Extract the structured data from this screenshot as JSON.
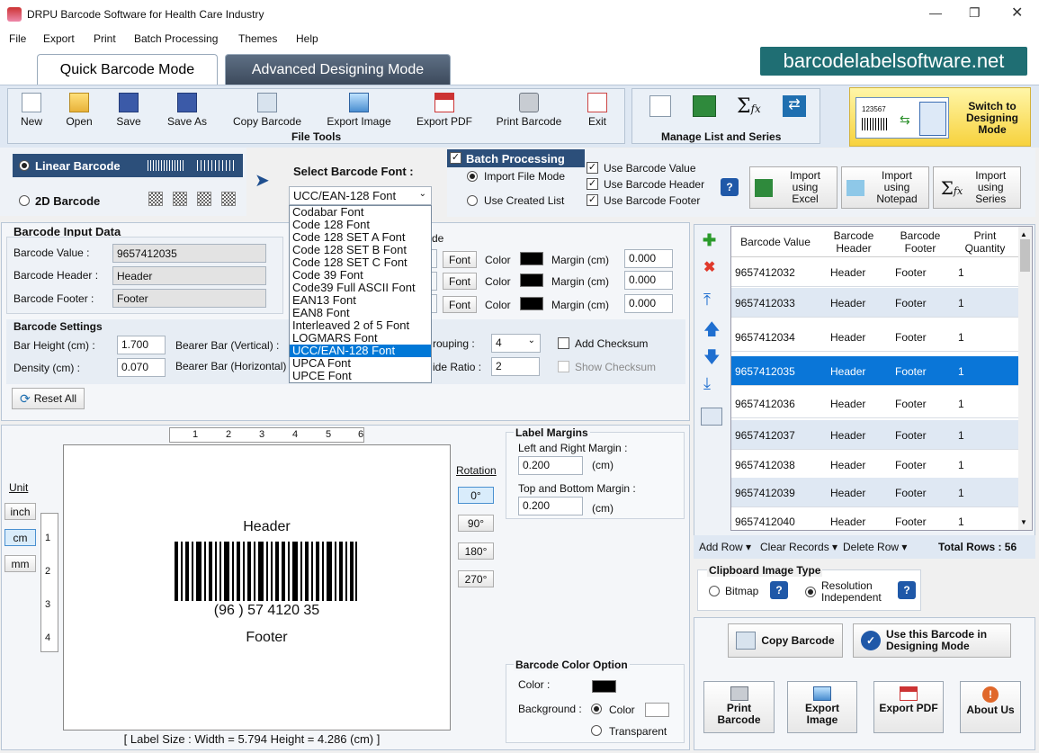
{
  "window": {
    "title": "DRPU Barcode Software for Health Care Industry"
  },
  "menu": [
    "File",
    "Export",
    "Print",
    "Batch Processing",
    "Themes",
    "Help"
  ],
  "tabs": {
    "quick": "Quick Barcode Mode",
    "advanced": "Advanced Designing Mode"
  },
  "brand": "barcodelabelsoftware.net",
  "toolbar": {
    "file_tools": [
      "New",
      "Open",
      "Save",
      "Save As",
      "Copy Barcode",
      "Export Image",
      "Export PDF",
      "Print Barcode",
      "Exit"
    ],
    "file_tools_label": "File Tools",
    "manage_label": "Manage List and Series",
    "switch": "Switch to Designing Mode",
    "switch_preview_num": "123567"
  },
  "barcode_type": {
    "linear": "Linear Barcode",
    "twod": "2D Barcode"
  },
  "font_select": {
    "label": "Select Barcode Font :",
    "value": "UCC/EAN-128 Font",
    "options": [
      "Codabar Font",
      "Code 128 Font",
      "Code 128 SET A Font",
      "Code 128 SET B Font",
      "Code 128 SET C Font",
      "Code 39 Font",
      "Code39 Full ASCII Font",
      "EAN13 Font",
      "EAN8 Font",
      "Interleaved 2 of 5 Font",
      "LOGMARS Font",
      "UCC/EAN-128 Font",
      "UPCA Font",
      "UPCE Font"
    ],
    "selected_index": 11
  },
  "batch": {
    "title": "Batch Processing",
    "import_file": "Import File Mode",
    "use_created": "Use Created List",
    "use_value": "Use Barcode Value",
    "use_header": "Use Barcode Header",
    "use_footer": "Use Barcode Footer",
    "import_excel": "Import using Excel",
    "import_notepad": "Import using Notepad",
    "import_series": "Import using Series"
  },
  "input": {
    "title": "Barcode Input Data",
    "value_label": "Barcode Value :",
    "value": "9657412035",
    "header_label": "Barcode Header :",
    "header": "Header",
    "footer_label": "Barcode Footer :",
    "footer": "Footer",
    "partial_label": "de"
  },
  "font_rows": [
    {
      "font": "Font",
      "color": "Color",
      "margin": "Margin (cm)",
      "value": "0.000"
    },
    {
      "font": "Font",
      "color": "Color",
      "margin": "Margin (cm)",
      "value": "0.000"
    },
    {
      "font": "Font",
      "color": "Color",
      "margin": "Margin (cm)",
      "value": "0.000"
    }
  ],
  "settings": {
    "title": "Barcode Settings",
    "bar_height_label": "Bar Height (cm) :",
    "bar_height": "1.700",
    "density_label": "Density (cm) :",
    "density": "0.070",
    "bearer_v": "Bearer Bar (Vertical) :",
    "bearer_h": "Bearer Bar (Horizontal)",
    "grouping_label": "rouping :",
    "grouping": "4",
    "ratio_label": "ide Ratio :",
    "ratio": "2",
    "add_checksum": "Add Checksum",
    "show_checksum": "Show Checksum",
    "reset": "Reset All"
  },
  "preview": {
    "header": "Header",
    "text": "(96 ) 57 4120 35",
    "footer": "Footer",
    "unit_label": "Unit",
    "units": [
      "inch",
      "cm",
      "mm"
    ],
    "ruler_h": [
      "1",
      "2",
      "3",
      "4",
      "5",
      "6"
    ],
    "ruler_v": [
      "1",
      "2",
      "3",
      "4"
    ],
    "rotation_label": "Rotation",
    "rotations": [
      "0°",
      "90°",
      "180°",
      "270°"
    ],
    "status": "[ Label Size : Width = 5.794  Height = 4.286 (cm) ]"
  },
  "margins": {
    "title": "Label Margins",
    "lr_label": "Left and Right Margin :",
    "lr": "0.200",
    "tb_label": "Top and Bottom Margin :",
    "tb": "0.200",
    "unit": "(cm)"
  },
  "color_option": {
    "title": "Barcode Color Option",
    "color_label": "Color :",
    "bg_label": "Background :",
    "color_opt": "Color",
    "transparent": "Transparent"
  },
  "grid": {
    "headers": [
      "Barcode Value",
      "Barcode Header",
      "Barcode Footer",
      "Print Quantity"
    ],
    "rows": [
      [
        "9657412032",
        "Header",
        "Footer",
        "1"
      ],
      [
        "9657412033",
        "Header",
        "Footer",
        "1"
      ],
      [
        "9657412034",
        "Header",
        "Footer",
        "1"
      ],
      [
        "9657412035",
        "Header",
        "Footer",
        "1"
      ],
      [
        "9657412036",
        "Header",
        "Footer",
        "1"
      ],
      [
        "9657412037",
        "Header",
        "Footer",
        "1"
      ],
      [
        "9657412038",
        "Header",
        "Footer",
        "1"
      ],
      [
        "9657412039",
        "Header",
        "Footer",
        "1"
      ],
      [
        "9657412040",
        "Header",
        "Footer",
        "1"
      ]
    ],
    "selected_row": 3,
    "add_row": "Add Row",
    "clear": "Clear Records",
    "delete": "Delete Row",
    "total": "Total Rows : 56"
  },
  "clipboard": {
    "title": "Clipboard Image Type",
    "bitmap": "Bitmap",
    "resolution": "Resolution Independent"
  },
  "actions": {
    "copy": "Copy Barcode",
    "use_design": "Use this Barcode in Designing Mode",
    "print": "Print Barcode",
    "export_image": "Export Image",
    "export_pdf": "Export PDF",
    "about": "About Us"
  }
}
